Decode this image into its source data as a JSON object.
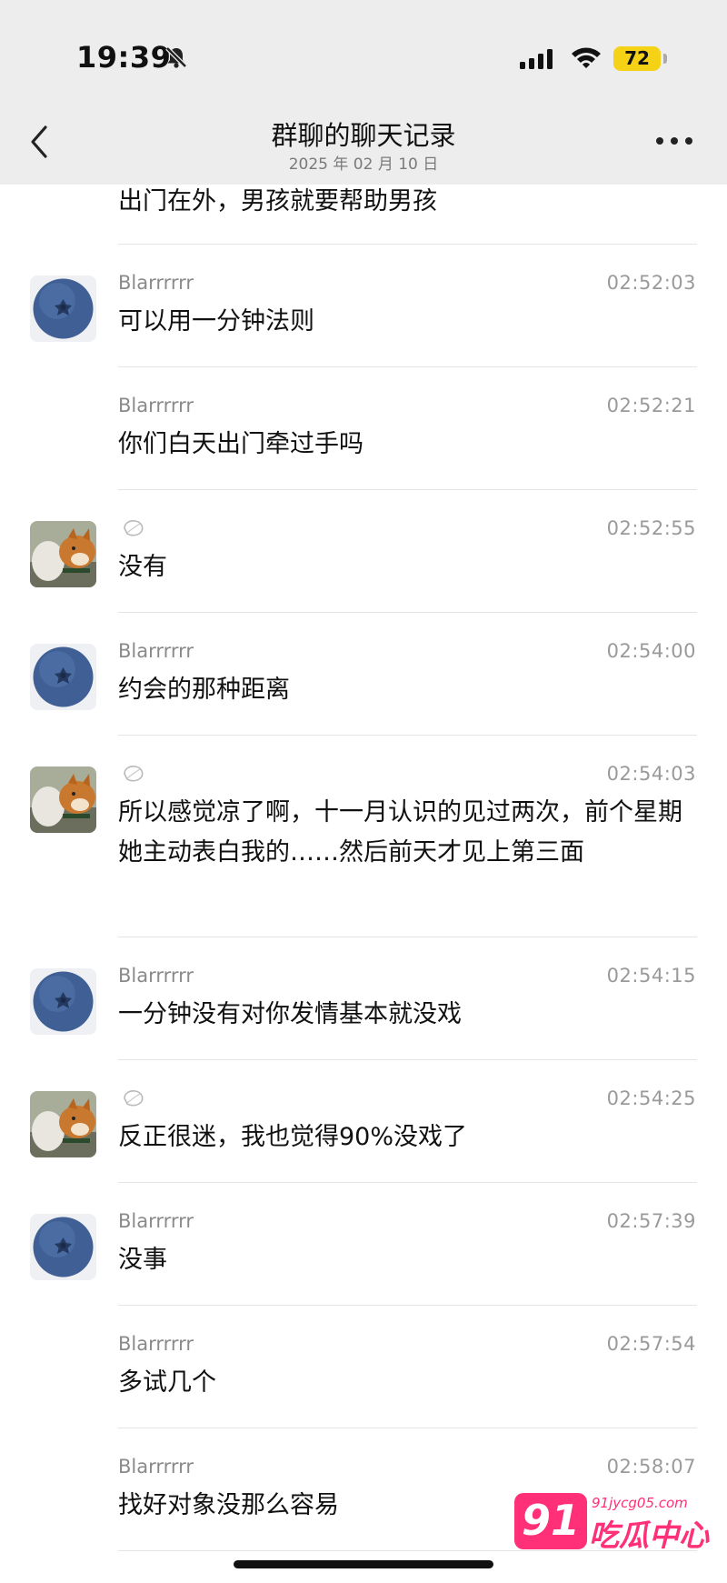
{
  "status_bar": {
    "time": "19:39",
    "battery": "72"
  },
  "header": {
    "title": "群聊的聊天记录",
    "date": "2025 年 02 月 10 日"
  },
  "messages": [
    {
      "sender": "",
      "time": "",
      "text": "出门在外，男孩就要帮助男孩"
    },
    {
      "sender": "Blarrrrrr",
      "time": "02:52:03",
      "text": "可以用一分钟法则",
      "avatar": "blueberry"
    },
    {
      "sender": "Blarrrrrr",
      "time": "02:52:21",
      "text": "你们白天出门牵过手吗"
    },
    {
      "sender": "",
      "time": "02:52:55",
      "text": "没有",
      "avatar": "dog"
    },
    {
      "sender": "Blarrrrrr",
      "time": "02:54:00",
      "text": "约会的那种距离",
      "avatar": "blueberry"
    },
    {
      "sender": "",
      "time": "02:54:03",
      "text": "所以感觉凉了啊，十一月认识的见过两次，前个星期她主动表白我的……然后前天才见上第三面",
      "avatar": "dog"
    },
    {
      "sender": "Blarrrrrr",
      "time": "02:54:15",
      "text": "一分钟没有对你发情基本就没戏",
      "avatar": "blueberry"
    },
    {
      "sender": "",
      "time": "02:54:25",
      "text": "反正很迷，我也觉得90%没戏了",
      "avatar": "dog"
    },
    {
      "sender": "Blarrrrrr",
      "time": "02:57:39",
      "text": "没事",
      "avatar": "blueberry"
    },
    {
      "sender": "Blarrrrrr",
      "time": "02:57:54",
      "text": "多试几个"
    },
    {
      "sender": "Blarrrrrr",
      "time": "02:58:07",
      "text": "找好对象没那么容易"
    }
  ],
  "watermark": {
    "logo": "91",
    "url": "91jycg05.com",
    "name": "吃瓜中心"
  },
  "colors": {
    "header_bg": "#ededed",
    "battery": "#f5d216",
    "watermark": "#ff2f78"
  }
}
